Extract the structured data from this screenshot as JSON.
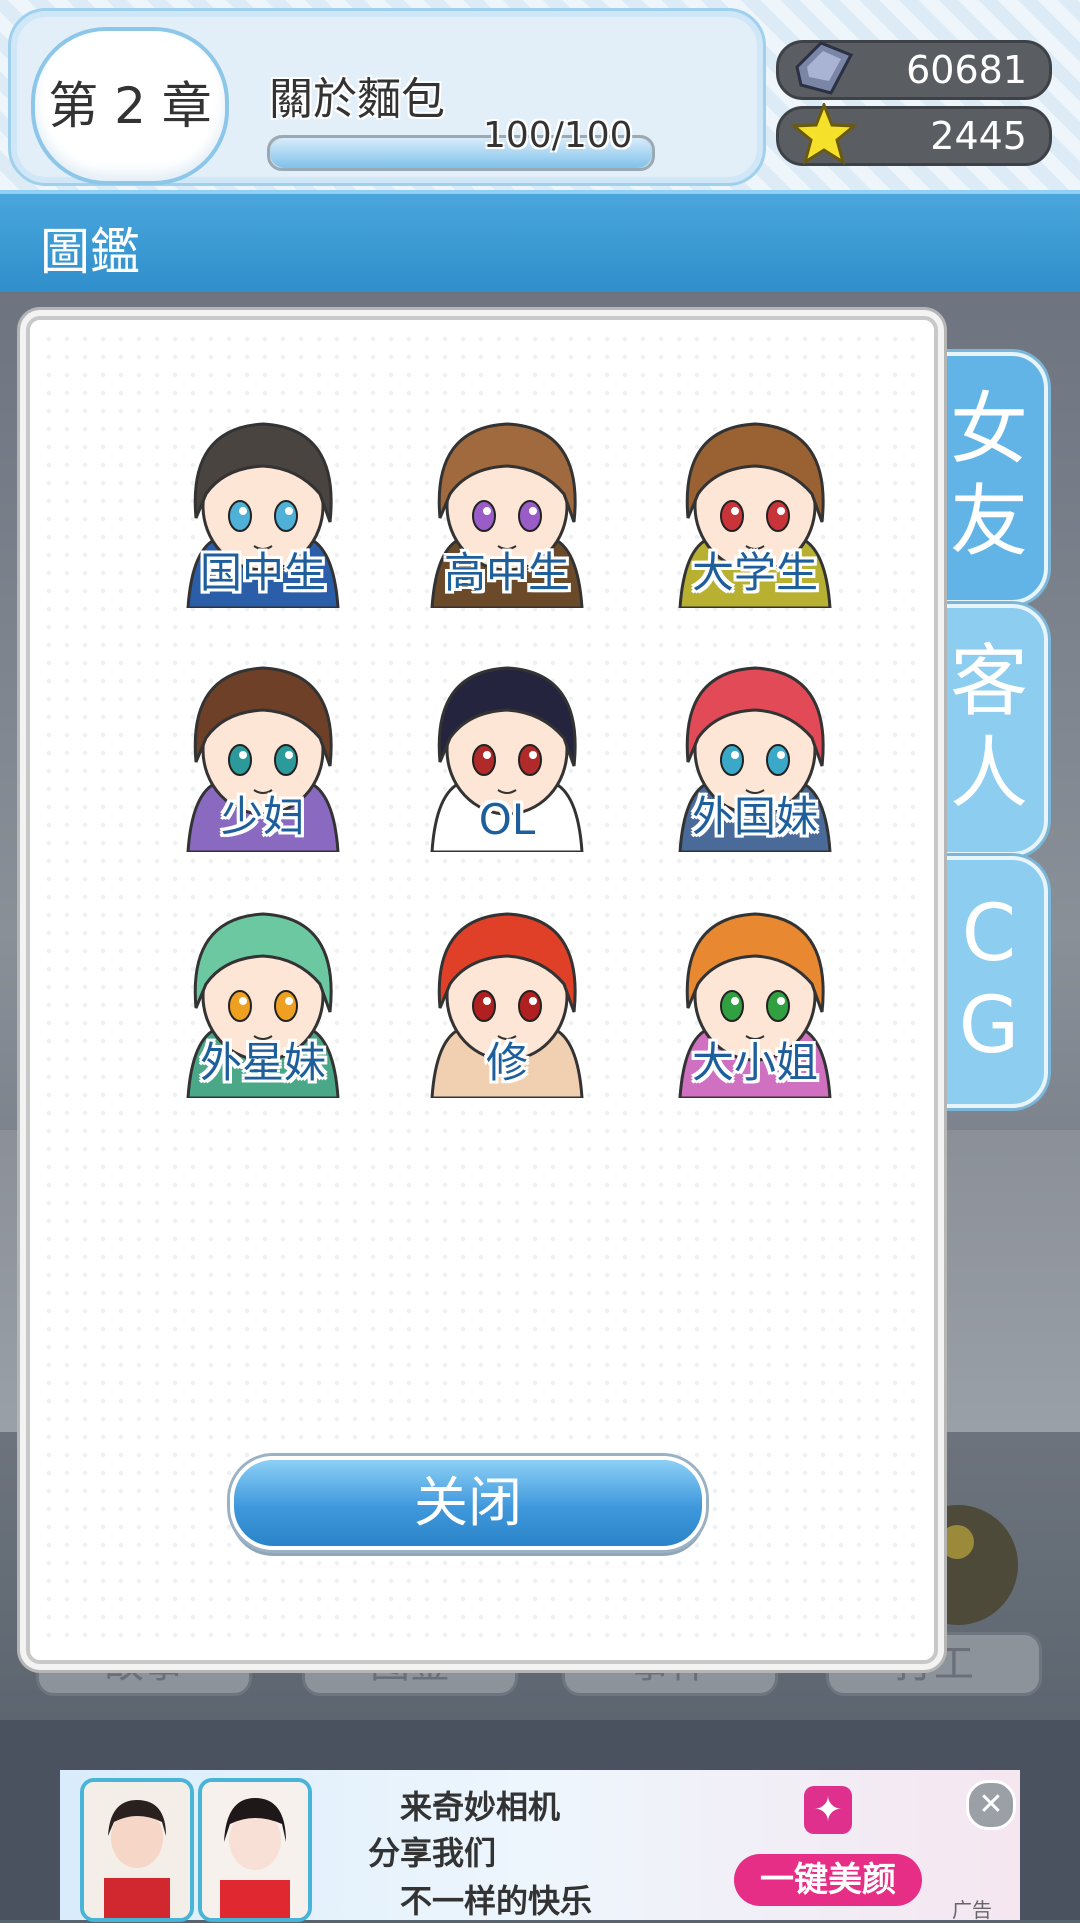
{
  "header": {
    "chapter_label": "第 2 章",
    "chapter_title": "關於麵包",
    "progress_text": "100/100",
    "progress_fraction": 1.0
  },
  "currencies": {
    "gems": {
      "icon": "gem-stone-icon",
      "value": "60681"
    },
    "stars": {
      "icon": "star-icon",
      "value": "2445"
    }
  },
  "section": {
    "title": "圖鑑"
  },
  "side_tabs": [
    {
      "label_top": "女",
      "label_bottom": "友",
      "active": true
    },
    {
      "label_top": "客",
      "label_bottom": "人",
      "active": false
    },
    {
      "label_top": "C",
      "label_bottom": "G",
      "active": false
    }
  ],
  "characters": [
    {
      "label": "国中生",
      "hair": "#4a4440",
      "eyes": "#4fb0d8",
      "accent": "#2a5ea8"
    },
    {
      "label": "高中生",
      "hair": "#a06a3e",
      "eyes": "#9a5cc6",
      "accent": "#6b4a2a"
    },
    {
      "label": "大学生",
      "hair": "#9a6232",
      "eyes": "#c8343a",
      "accent": "#b8b030"
    },
    {
      "label": "少妇",
      "hair": "#6e4028",
      "eyes": "#2c9a9a",
      "accent": "#8a6ac0"
    },
    {
      "label": "OL",
      "hair": "#24243e",
      "eyes": "#b02a2a",
      "accent": "#ffffff"
    },
    {
      "label": "外国妹",
      "hair": "#e24a58",
      "eyes": "#3aa8c8",
      "accent": "#4a6a9a"
    },
    {
      "label": "外星妹",
      "hair": "#6cc8a0",
      "eyes": "#f0a020",
      "accent": "#4aa888"
    },
    {
      "label": "修",
      "hair": "#e04028",
      "eyes": "#b02020",
      "accent": "#f0d0b0"
    },
    {
      "label": "大小姐",
      "hair": "#e88830",
      "eyes": "#30a040",
      "accent": "#d070c0"
    }
  ],
  "close_button": {
    "label": "关闭"
  },
  "background_tabs": [
    "故事",
    "图鉴",
    "事件",
    "打工"
  ],
  "ad": {
    "line1": "来奇妙相机",
    "line2": "分享我们",
    "line3": "不一样的快乐",
    "button": "一键美颜",
    "close": "✕",
    "tag": "广告",
    "badge_icon": "sparkle-icon"
  }
}
